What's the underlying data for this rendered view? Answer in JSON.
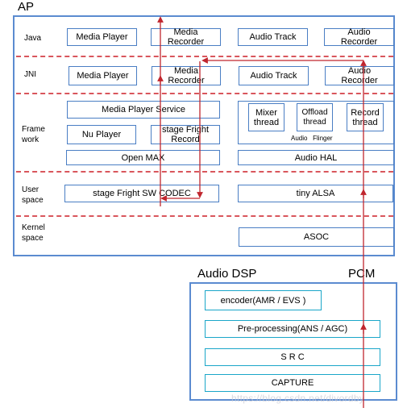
{
  "ap": {
    "title": "AP",
    "layers": {
      "java": "Java",
      "jni": "JNI",
      "framework": "Frame\nwork",
      "user_space": "User\nspace",
      "kernel_space": "Kernel\nspace"
    },
    "java_row": [
      "Media Player",
      "Media\nRecorder",
      "Audio Track",
      "Audio\nRecorder"
    ],
    "jni_row": [
      "Media Player",
      "Media\nRecorder",
      "Audio Track",
      "Audio\nRecorder"
    ],
    "framework": {
      "media_player_service": "Media Player Service",
      "nu_player": "Nu Player",
      "stagefright_record": "stage Fright\nRecord",
      "open_max": "Open MAX",
      "mixer_thread": "Mixer\nthread",
      "offload_thread": "Offload\nthread",
      "record_thread": "Record\nthread",
      "audio_flinger": "Audio   Flinger",
      "audio_hal": "Audio HAL"
    },
    "user_space": {
      "sw_codec": "stage Fright  SW  CODEC",
      "tiny_alsa": "tiny ALSA"
    },
    "kernel_space": {
      "asoc": "ASOC"
    }
  },
  "dsp": {
    "title": "Audio DSP",
    "pcm_label": "PCM",
    "blocks": [
      "encoder(AMR / EVS )",
      "Pre-processing(ANS / AGC)",
      "S R C",
      "CAPTURE"
    ]
  },
  "watermark": "https://blog.csdn.net/divordby",
  "colors": {
    "frame": "#5b8bd0",
    "box": "#4a7ec4",
    "dsp_box": "#1aa6c9",
    "divider": "#d9565c",
    "arrow": "#c0262e"
  }
}
